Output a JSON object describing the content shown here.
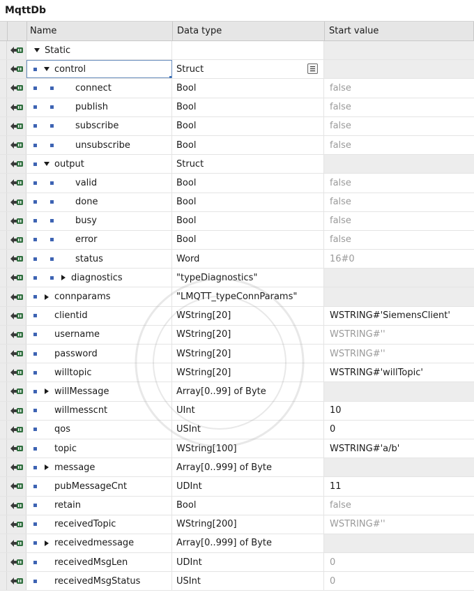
{
  "window": {
    "title": "MqttDb"
  },
  "columns": {
    "name": "Name",
    "data_type": "Data type",
    "start_value": "Start value"
  },
  "colors": {
    "accent": "#3d63b3",
    "dim_text": "#9a9a9a",
    "row_gray": "#ededed"
  },
  "rows": [
    {
      "level": 0,
      "toggle": "down",
      "bullet": false,
      "name": "Static",
      "type": "",
      "start": "",
      "start_style": "none"
    },
    {
      "level": 1,
      "toggle": "down",
      "bullet": true,
      "name": "control",
      "type": "Struct",
      "start": "",
      "start_style": "none",
      "selected": true,
      "button": true
    },
    {
      "level": 2,
      "toggle": "none",
      "bullet": true,
      "name": "connect",
      "type": "Bool",
      "start": "false",
      "start_style": "dim"
    },
    {
      "level": 2,
      "toggle": "none",
      "bullet": true,
      "name": "publish",
      "type": "Bool",
      "start": "false",
      "start_style": "dim"
    },
    {
      "level": 2,
      "toggle": "none",
      "bullet": true,
      "name": "subscribe",
      "type": "Bool",
      "start": "false",
      "start_style": "dim"
    },
    {
      "level": 2,
      "toggle": "none",
      "bullet": true,
      "name": "unsubscribe",
      "type": "Bool",
      "start": "false",
      "start_style": "dim"
    },
    {
      "level": 1,
      "toggle": "down",
      "bullet": true,
      "name": "output",
      "type": "Struct",
      "start": "",
      "start_style": "none"
    },
    {
      "level": 2,
      "toggle": "none",
      "bullet": true,
      "name": "valid",
      "type": "Bool",
      "start": "false",
      "start_style": "dim"
    },
    {
      "level": 2,
      "toggle": "none",
      "bullet": true,
      "name": "done",
      "type": "Bool",
      "start": "false",
      "start_style": "dim"
    },
    {
      "level": 2,
      "toggle": "none",
      "bullet": true,
      "name": "busy",
      "type": "Bool",
      "start": "false",
      "start_style": "dim"
    },
    {
      "level": 2,
      "toggle": "none",
      "bullet": true,
      "name": "error",
      "type": "Bool",
      "start": "false",
      "start_style": "dim"
    },
    {
      "level": 2,
      "toggle": "none",
      "bullet": true,
      "name": "status",
      "type": "Word",
      "start": "16#0",
      "start_style": "dim"
    },
    {
      "level": 2,
      "toggle": "right",
      "bullet": true,
      "name": "diagnostics",
      "type": "\"typeDiagnostics\"",
      "start": "",
      "start_style": "none"
    },
    {
      "level": 1,
      "toggle": "right",
      "bullet": true,
      "name": "connparams",
      "type": "\"LMQTT_typeConnParams\"",
      "start": "",
      "start_style": "none"
    },
    {
      "level": 1,
      "toggle": "none",
      "bullet": true,
      "name": "clientid",
      "type": "WString[20]",
      "start": "WSTRING#'SiemensClient'",
      "start_style": "normal"
    },
    {
      "level": 1,
      "toggle": "none",
      "bullet": true,
      "name": "username",
      "type": "WString[20]",
      "start": "WSTRING#''",
      "start_style": "dim"
    },
    {
      "level": 1,
      "toggle": "none",
      "bullet": true,
      "name": "password",
      "type": "WString[20]",
      "start": "WSTRING#''",
      "start_style": "dim"
    },
    {
      "level": 1,
      "toggle": "none",
      "bullet": true,
      "name": "willtopic",
      "type": "WString[20]",
      "start": "WSTRING#'willTopic'",
      "start_style": "normal"
    },
    {
      "level": 1,
      "toggle": "right",
      "bullet": true,
      "name": "willMessage",
      "type": "Array[0..99] of Byte",
      "start": "",
      "start_style": "none"
    },
    {
      "level": 1,
      "toggle": "none",
      "bullet": true,
      "name": "willmesscnt",
      "type": "UInt",
      "start": "10",
      "start_style": "normal"
    },
    {
      "level": 1,
      "toggle": "none",
      "bullet": true,
      "name": "qos",
      "type": "USInt",
      "start": "0",
      "start_style": "normal"
    },
    {
      "level": 1,
      "toggle": "none",
      "bullet": true,
      "name": "topic",
      "type": "WString[100]",
      "start": "WSTRING#'a/b'",
      "start_style": "normal"
    },
    {
      "level": 1,
      "toggle": "right",
      "bullet": true,
      "name": "message",
      "type": "Array[0..999] of Byte",
      "start": "",
      "start_style": "none"
    },
    {
      "level": 1,
      "toggle": "none",
      "bullet": true,
      "name": "pubMessageCnt",
      "type": "UDInt",
      "start": "11",
      "start_style": "normal"
    },
    {
      "level": 1,
      "toggle": "none",
      "bullet": true,
      "name": "retain",
      "type": "Bool",
      "start": "false",
      "start_style": "dim"
    },
    {
      "level": 1,
      "toggle": "none",
      "bullet": true,
      "name": "receivedTopic",
      "type": "WString[200]",
      "start": "WSTRING#''",
      "start_style": "dim"
    },
    {
      "level": 1,
      "toggle": "right",
      "bullet": true,
      "name": "receivedmessage",
      "type": "Array[0..999] of Byte",
      "start": "",
      "start_style": "none"
    },
    {
      "level": 1,
      "toggle": "none",
      "bullet": true,
      "name": "receivedMsgLen",
      "type": "UDInt",
      "start": "0",
      "start_style": "dim"
    },
    {
      "level": 1,
      "toggle": "none",
      "bullet": true,
      "name": "receivedMsgStatus",
      "type": "USInt",
      "start": "0",
      "start_style": "dim"
    }
  ]
}
